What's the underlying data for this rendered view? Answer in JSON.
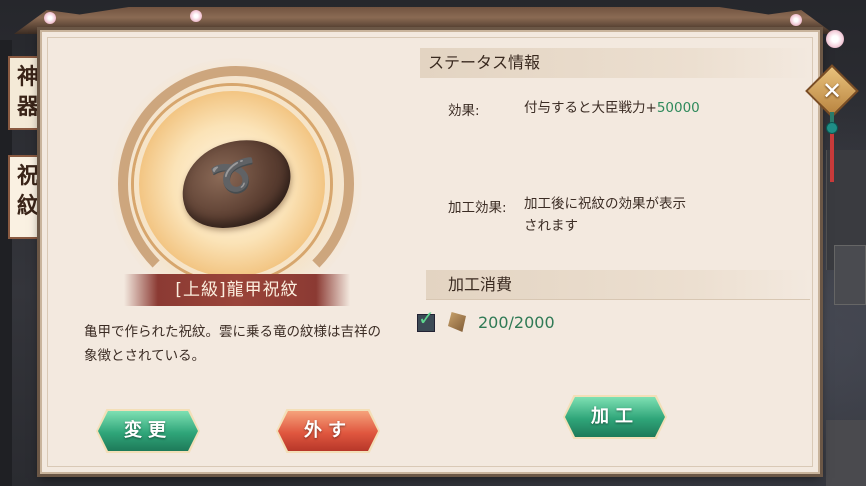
{
  "tabs": [
    {
      "label_chars": [
        "神",
        "器"
      ]
    },
    {
      "label_chars": [
        "祝",
        "紋"
      ]
    }
  ],
  "item": {
    "name": "[上級]龍甲祝紋",
    "description_line1": "亀甲で作られた祝紋。雲に乗る竜の紋様は吉祥の",
    "description_line2": "象徴とされている。"
  },
  "buttons": {
    "change": "変更",
    "remove": "外す",
    "process": "加工"
  },
  "status": {
    "header": "ステータス情報",
    "effect_label": "効果:",
    "effect_text": "付与すると大臣戦力+",
    "effect_value": "50000",
    "process_effect_label": "加工効果:",
    "process_effect_line1": "加工後に祝紋の効果が表示",
    "process_effect_line2": "されます"
  },
  "cost": {
    "header": "加工消費",
    "material_count": "200/2000",
    "checked": true
  },
  "colors": {
    "panel_bg": "#f3e9df",
    "accent_red": "#8b3a33",
    "green_button": "#2fa579",
    "red_button": "#e0573f",
    "value_green": "#2f8a5c"
  },
  "icons": {
    "close": "close-icon",
    "item": "dragon-turtle-shell-icon",
    "material": "material-fragment-icon",
    "check": "checkmark-icon"
  }
}
